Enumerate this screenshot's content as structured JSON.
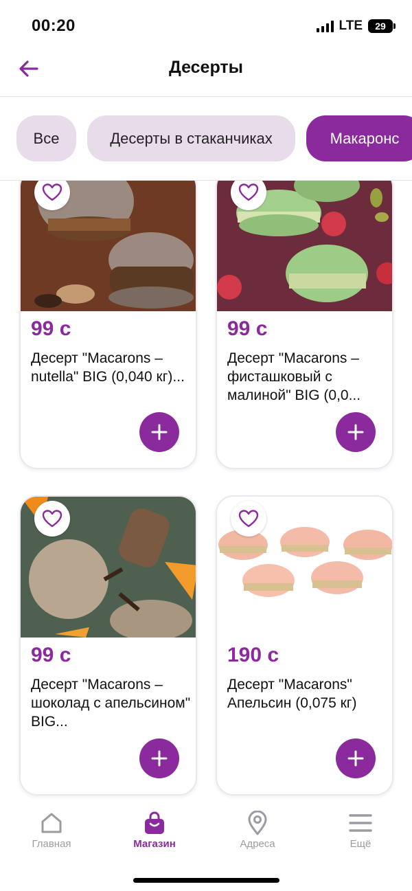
{
  "status": {
    "time": "00:20",
    "network": "LTE",
    "battery": "29"
  },
  "header": {
    "title": "Десерты"
  },
  "categories": [
    {
      "label": "Все",
      "active": false
    },
    {
      "label": "Десерты в стаканчиках",
      "active": false
    },
    {
      "label": "Макаронс",
      "active": true
    }
  ],
  "products": [
    {
      "price": "99 с",
      "name": "Десерт \"Macarons – nutella\" BIG (0,040 кг)..."
    },
    {
      "price": "99 с",
      "name": "Десерт \"Macarons – фисташковый с малиной\" BIG (0,0..."
    },
    {
      "price": "99 с",
      "name": "Десерт \"Macarons – шоколад с апельсином\" BIG..."
    },
    {
      "price": "190 с",
      "name": "Десерт \"Macarons\" Апельсин (0,075 кг)"
    }
  ],
  "tabs": [
    {
      "label": "Главная",
      "icon": "home-icon",
      "active": false
    },
    {
      "label": "Магазин",
      "icon": "shopping-bag-icon",
      "active": true
    },
    {
      "label": "Адреса",
      "icon": "location-pin-icon",
      "active": false
    },
    {
      "label": "Ещё",
      "icon": "menu-icon",
      "active": false
    }
  ],
  "colors": {
    "accent": "#8b2a9d",
    "chip_bg": "#e8dcea",
    "inactive_tab": "#9b9ba2"
  }
}
